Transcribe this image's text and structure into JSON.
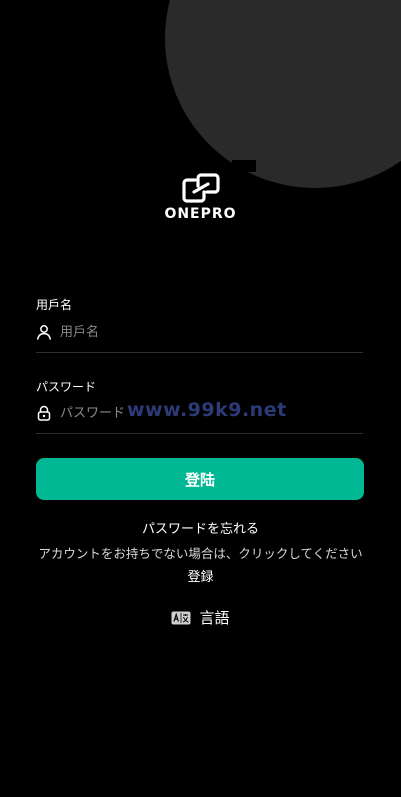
{
  "brand": {
    "name": "ONEPRO",
    "logo_icon": "onepro-logo-icon"
  },
  "form": {
    "username": {
      "label": "用戶名",
      "placeholder": "用戶名",
      "icon": "user-icon"
    },
    "password": {
      "label": "パスワード",
      "placeholder": "パスワード",
      "icon": "lock-icon"
    },
    "submit_label": "登陆"
  },
  "watermark": "www.99k9.net",
  "links": {
    "forgot_password": "パスワードを忘れる",
    "register_hint": "アカウントをお持ちでない場合は、クリックしてください",
    "register": "登録"
  },
  "language": {
    "label": "言語",
    "icon": "translate-icon"
  },
  "colors": {
    "background": "#000000",
    "accent": "#00b894",
    "decor_circle": "#2a2a2a",
    "watermark": "#2c3b78"
  }
}
